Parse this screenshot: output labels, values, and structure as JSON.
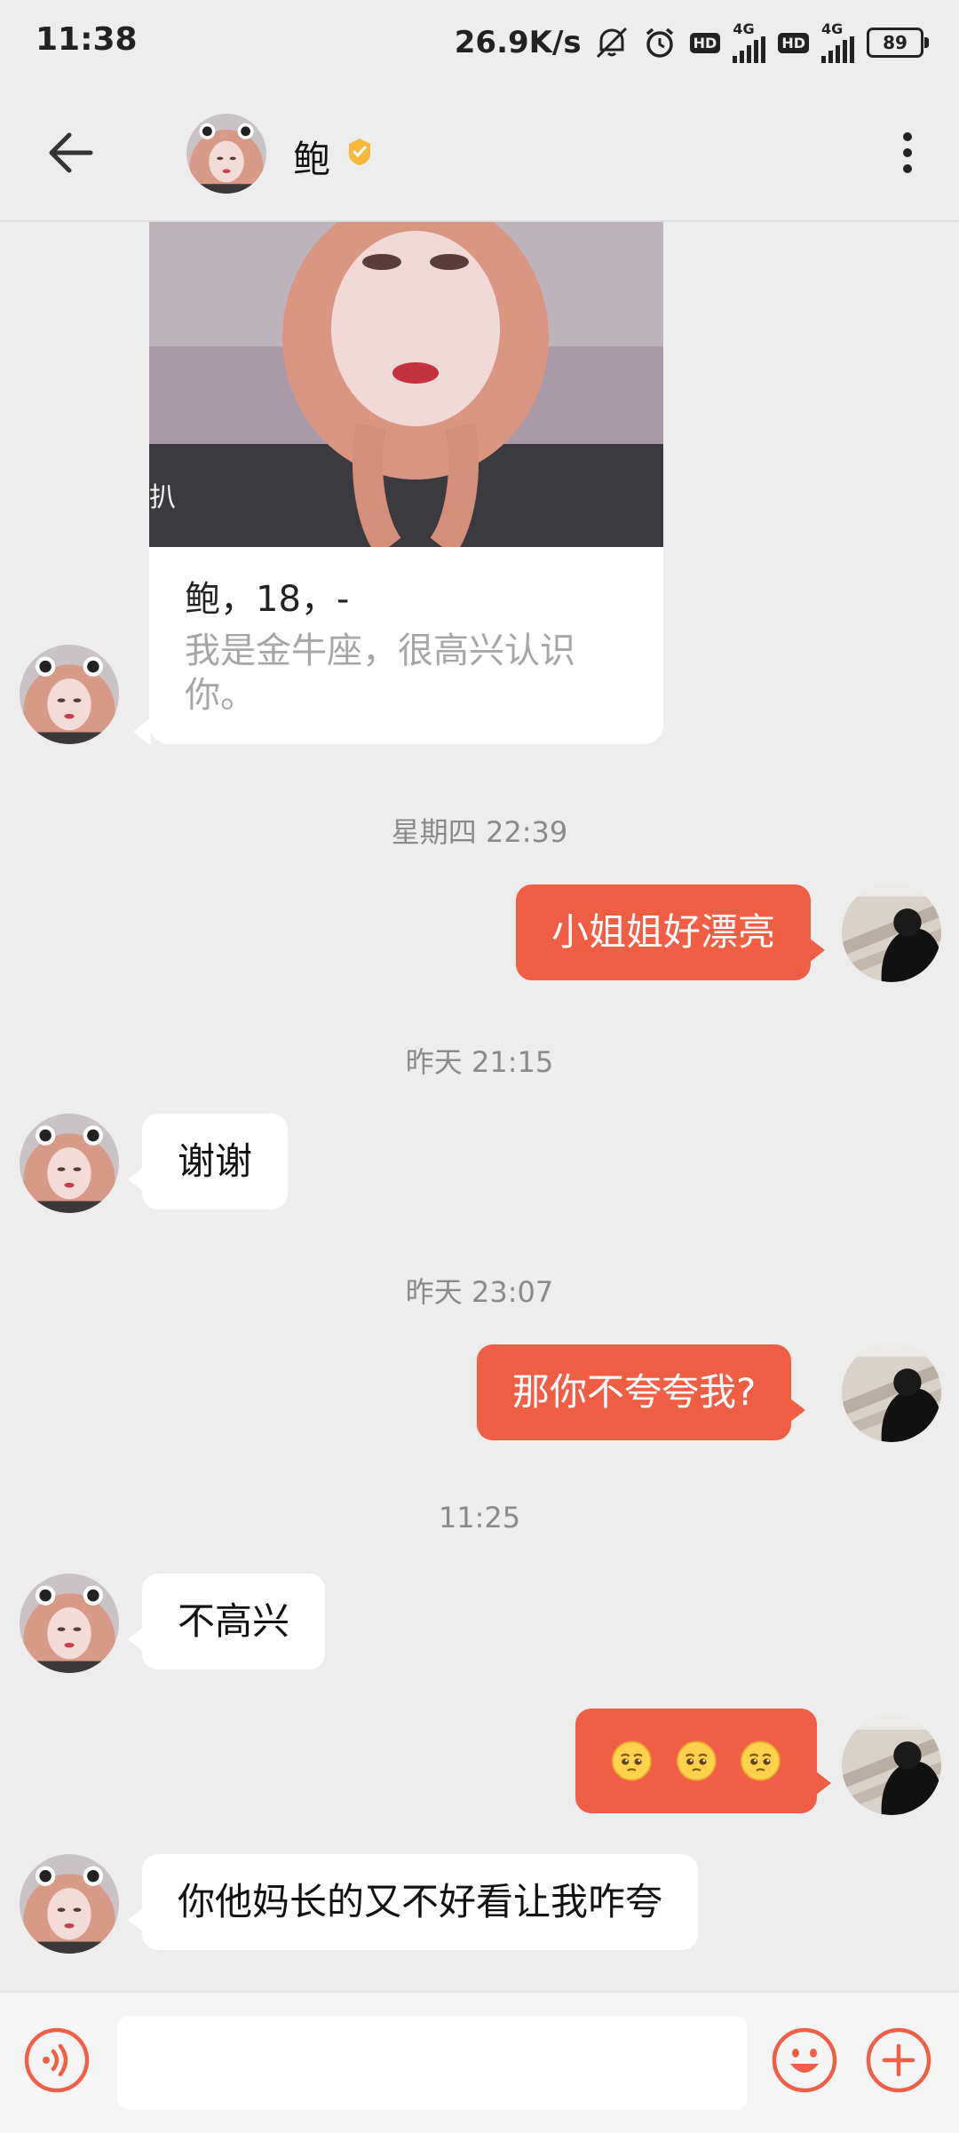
{
  "status_bar": {
    "time": "11:38",
    "net_speed": "26.9K/s",
    "hd": "HD",
    "net_type": "4G",
    "battery": "89"
  },
  "header": {
    "contact_name": "鲍"
  },
  "profile_card": {
    "photo_caption": "扒",
    "title": "鲍，18，-",
    "intro": "我是金牛座，很高兴认识你。"
  },
  "messages": [
    {
      "type": "timestamp",
      "text": "星期四 22:39"
    },
    {
      "type": "outgoing",
      "text": "小姐姐好漂亮"
    },
    {
      "type": "timestamp",
      "text": "昨天 21:15"
    },
    {
      "type": "incoming",
      "text": "谢谢"
    },
    {
      "type": "timestamp",
      "text": "昨天 23:07"
    },
    {
      "type": "outgoing",
      "text": "那你不夸夸我?"
    },
    {
      "type": "timestamp",
      "text": "11:25"
    },
    {
      "type": "incoming",
      "text": "不高兴"
    },
    {
      "type": "outgoing",
      "emojis": [
        "pleading-face-emoji",
        "pleading-face-emoji",
        "pleading-face-emoji"
      ]
    },
    {
      "type": "incoming",
      "text": "你他妈长的又不好看让我咋夸"
    }
  ],
  "input_bar": {
    "placeholder": "",
    "value": ""
  },
  "icons": {
    "back": "arrow-left-icon",
    "verified": "verified-badge-icon",
    "more": "more-vertical-icon",
    "voice": "voice-icon",
    "emoji": "emoji-icon",
    "plus": "plus-icon"
  },
  "colors": {
    "accent": "#f05e45",
    "background": "#ededed",
    "verified": "#f5b83a"
  }
}
